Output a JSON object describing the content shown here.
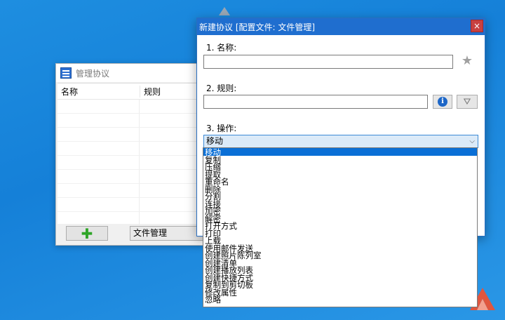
{
  "manage_window": {
    "title": "管理协议",
    "columns": [
      "名称",
      "规则"
    ],
    "add_icon_text": "✚",
    "profile_value": "文件管理",
    "rows": 9
  },
  "new_window": {
    "title": "新建协议 [配置文件: 文件管理]",
    "close_glyph": "×",
    "name_label": "1.  名称:",
    "rule_label": "2.  规则:",
    "action_label": "3.  操作:",
    "name_value": "",
    "rule_value": "",
    "action_selected": "移动",
    "star_glyph": "★",
    "info_glyph": "i",
    "filter_glyph": "⛛"
  },
  "dropdown": {
    "items": [
      "移动",
      "复制",
      "压缩",
      "提取",
      "重命名",
      "删除",
      "分割",
      "连接",
      "加密",
      "解密",
      "打开方式",
      "打印",
      "上载",
      "使用邮件发送",
      "创建照片陈列室",
      "创建清单",
      "创建播放列表",
      "创建快捷方式",
      "复制到剪切板",
      "修改属性",
      "忽略"
    ],
    "selected_index": 0
  }
}
